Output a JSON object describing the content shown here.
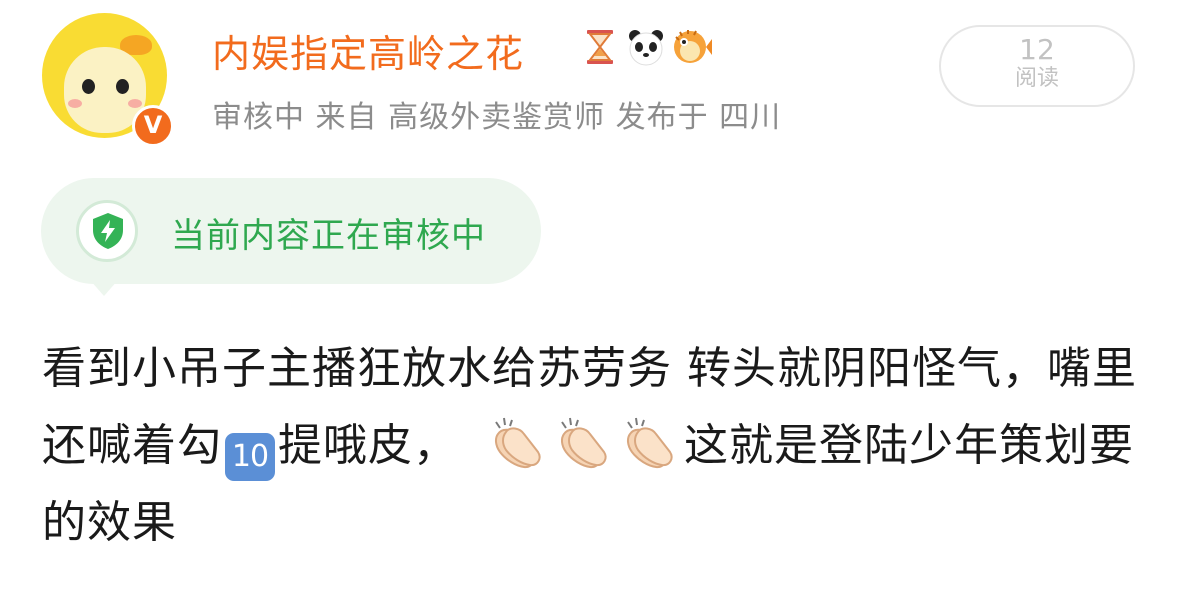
{
  "user": {
    "name": "内娱指定高岭之花",
    "verified_badge": "V",
    "title_badges": [
      "hourglass-icon",
      "panda-icon",
      "pufferfish-icon"
    ]
  },
  "meta": {
    "text": "审核中 来自 高级外卖鉴赏师  发布于 四川"
  },
  "reads": {
    "count": "12",
    "label": "阅读"
  },
  "review": {
    "text": "当前内容正在审核中",
    "icon": "shield-lightning-icon"
  },
  "post": {
    "part1": "看到小吊子主播狂放水给苏劳务 转头就阴阳怪气，嘴里还喊着勾",
    "keycap": "10",
    "part2": "提哦皮，",
    "claps": [
      "clapping-hands-icon",
      "clapping-hands-icon",
      "clapping-hands-icon"
    ],
    "part3": "这就是登陆少年策划要的效果"
  },
  "colors": {
    "accent": "#f26b1d",
    "review_green": "#2fa84f",
    "meta_gray": "#8c8c8c"
  }
}
